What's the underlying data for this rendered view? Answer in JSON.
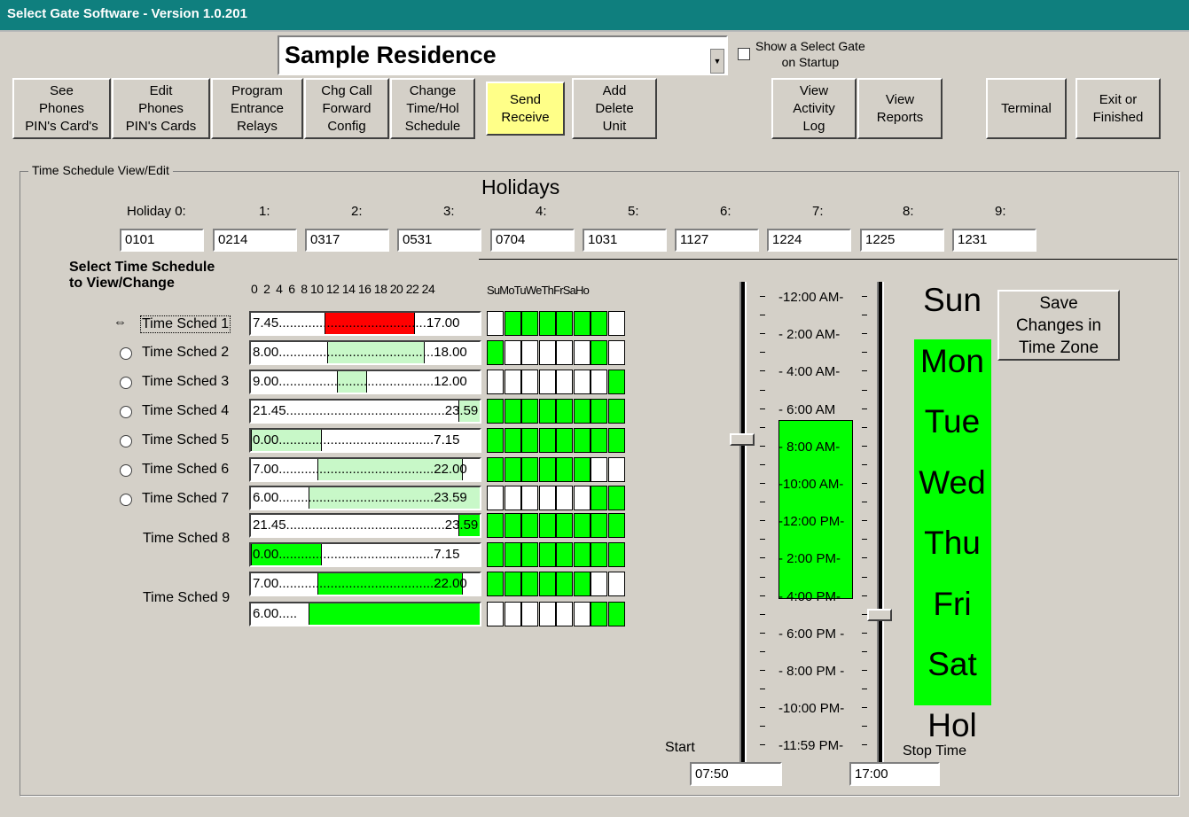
{
  "window": {
    "title": "Select Gate Software - Version 1.0.201"
  },
  "header": {
    "residence": "Sample Residence",
    "startup_checkbox_label": "Show a Select Gate\non Startup"
  },
  "toolbar": [
    {
      "label": "See\nPhones\nPIN's Card's"
    },
    {
      "label": "Edit\nPhones\nPIN's Cards"
    },
    {
      "label": "Program\nEntrance\nRelays"
    },
    {
      "label": "Chg Call\nForward\nConfig"
    },
    {
      "label": "Change\nTime/Hol\nSchedule"
    },
    {
      "label": "Send\nReceive"
    },
    {
      "label": "Add\nDelete\nUnit"
    },
    {
      "label": "View\nActivity\nLog"
    },
    {
      "label": "View\nReports"
    },
    {
      "label": "Terminal"
    },
    {
      "label": "Exit or\nFinished"
    }
  ],
  "panel": {
    "group_label": "Time Schedule View/Edit",
    "holidays_title": "Holidays",
    "holiday_labels": [
      "Holiday  0:",
      "1:",
      "2:",
      "3:",
      "4:",
      "5:",
      "6:",
      "7:",
      "8:",
      "9:"
    ],
    "holiday_values": [
      "0101",
      "0214",
      "0317",
      "0531",
      "0704",
      "1031",
      "1127",
      "1224",
      "1225",
      "1231"
    ],
    "select_title": "Select Time Schedule\nto View/Change",
    "hour_scale": "0  2  4  6  8 10 12 14 16 18 20 22 24",
    "day_header": "SuMoTuWeThFrSaHo"
  },
  "schedules": [
    {
      "label": "Time Sched 1",
      "selected": true
    },
    {
      "label": "Time Sched 2"
    },
    {
      "label": "Time Sched 3"
    },
    {
      "label": "Time Sched 4"
    },
    {
      "label": "Time Sched 5"
    },
    {
      "label": "Time Sched 6"
    },
    {
      "label": "Time Sched 7"
    },
    {
      "label": "Time Sched 8"
    },
    {
      "label": "Time Sched 9"
    }
  ],
  "bars": [
    {
      "text": "7.45........................................17.00",
      "start": 7.75,
      "end": 17.0,
      "color": "#ff0000",
      "days": [
        0,
        1,
        1,
        1,
        1,
        1,
        1,
        0
      ]
    },
    {
      "text": "8.00..........................................18.00",
      "start": 8.0,
      "end": 18.0,
      "color": "#c8f8c8",
      "days": [
        1,
        0,
        0,
        0,
        0,
        0,
        1,
        0
      ]
    },
    {
      "text": "9.00..........................................12.00",
      "start": 9.0,
      "end": 12.0,
      "color": "#c8f8c8",
      "days": [
        0,
        0,
        0,
        0,
        0,
        0,
        0,
        1
      ]
    },
    {
      "text": "21.45...........................................23.59",
      "start": 21.75,
      "end": 23.98,
      "color": "#c8f8c8",
      "days": [
        1,
        1,
        1,
        1,
        1,
        1,
        1,
        1
      ]
    },
    {
      "text": "0.00..........................................7.15",
      "start": 0.0,
      "end": 7.25,
      "color": "#c8f8c8",
      "days": [
        1,
        1,
        1,
        1,
        1,
        1,
        1,
        1
      ]
    },
    {
      "text": "7.00..........................................22.00",
      "start": 7.0,
      "end": 22.0,
      "color": "#c8f8c8",
      "days": [
        1,
        1,
        1,
        1,
        1,
        1,
        0,
        0
      ]
    },
    {
      "text": "6.00..........................................23.59",
      "start": 6.0,
      "end": 23.98,
      "color": "#c8f8c8",
      "days": [
        0,
        0,
        0,
        0,
        0,
        0,
        1,
        1
      ]
    },
    {
      "text": "21.45...........................................23.59",
      "start": 21.75,
      "end": 23.98,
      "color": "#00ff00",
      "days": [
        1,
        1,
        1,
        1,
        1,
        1,
        1,
        1
      ]
    },
    {
      "text": "0.00..........................................7.15",
      "start": 0.0,
      "end": 7.25,
      "color": "#00ff00",
      "days": [
        1,
        1,
        1,
        1,
        1,
        1,
        1,
        1
      ]
    },
    {
      "text": "7.00..........................................22.00",
      "start": 7.0,
      "end": 22.0,
      "color": "#00ff00",
      "days": [
        1,
        1,
        1,
        1,
        1,
        1,
        0,
        0
      ]
    },
    {
      "text": "6.00.....",
      "start": 6.0,
      "end": 23.98,
      "color": "#00ff00",
      "days": [
        0,
        0,
        0,
        0,
        0,
        0,
        1,
        1
      ]
    }
  ],
  "timeline": {
    "labels": [
      "-12:00 AM-",
      "- 2:00 AM-",
      "- 4:00 AM-",
      "- 6:00 AM",
      "- 8:00 AM-",
      "-10:00 AM-",
      "-12:00 PM-",
      "- 2:00 PM-",
      "- 4:00 PM-",
      "- 6:00 PM -",
      "- 8:00 PM -",
      "-10:00 PM-",
      "-11:59 PM-"
    ],
    "highlight_start_hour": 7.83,
    "highlight_end_hour": 17.0
  },
  "day_column": [
    "Sun",
    "Mon",
    "Tue",
    "Wed",
    "Thu",
    "Fri",
    "Sat",
    "Hol"
  ],
  "save_button": "Save\nChanges in\nTime Zone",
  "start": {
    "label": "Start",
    "value": "07:50"
  },
  "stop": {
    "label": "Stop Time",
    "value": "17:00"
  },
  "colors": {
    "title_bar": "#0f7f7e",
    "active_green": "#00ff00",
    "light_green": "#c8f8c8",
    "selected_red": "#ff0000",
    "send_button": "#ffff88"
  }
}
